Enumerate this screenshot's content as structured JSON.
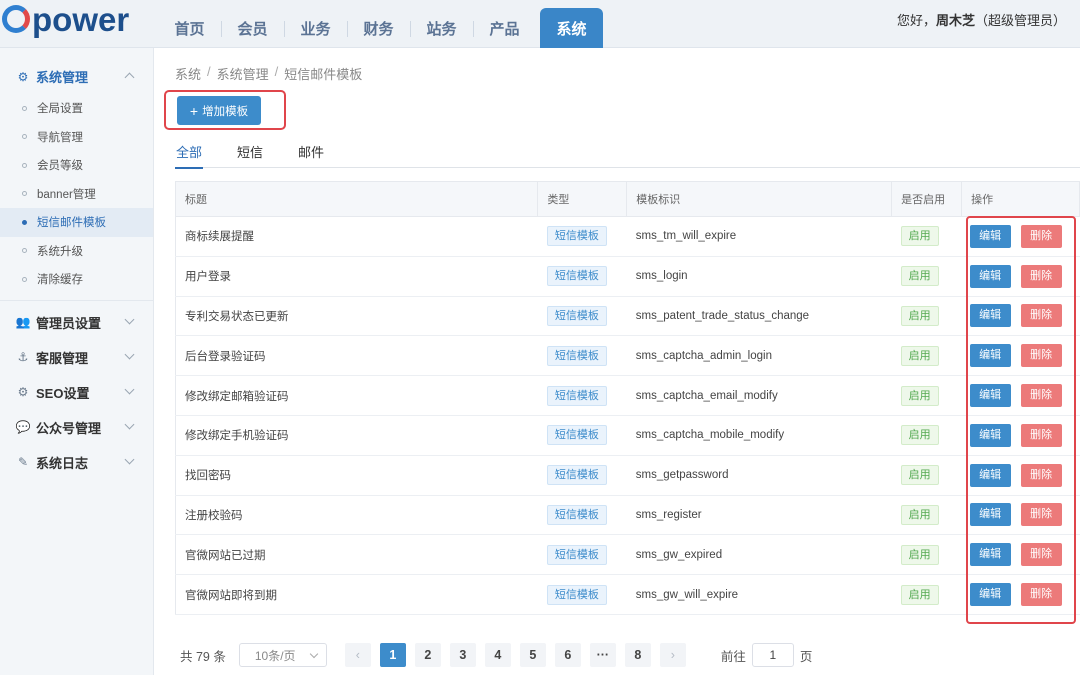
{
  "header": {
    "logo_text": "power",
    "nav": [
      "首页",
      "会员",
      "业务",
      "财务",
      "站务",
      "产品",
      "系统"
    ],
    "greeting_prefix": "您好，",
    "user_name": "周木芝",
    "user_role": "（超级管理员）"
  },
  "sidebar": {
    "sections": [
      {
        "title": "系统管理",
        "icon": "gears-icon",
        "items": [
          "全局设置",
          "导航管理",
          "会员等级",
          "banner管理",
          "短信邮件模板",
          "系统升级",
          "清除缓存"
        ]
      },
      {
        "title": "管理员设置",
        "icon": "users-icon"
      },
      {
        "title": "客服管理",
        "icon": "headset-icon"
      },
      {
        "title": "SEO设置",
        "icon": "gear-icon"
      },
      {
        "title": "公众号管理",
        "icon": "wechat-icon"
      },
      {
        "title": "系统日志",
        "icon": "log-icon"
      }
    ]
  },
  "breadcrumb": [
    "系统",
    "系统管理",
    "短信邮件模板"
  ],
  "add_button": "增加模板",
  "tabs": [
    "全部",
    "短信",
    "邮件"
  ],
  "table": {
    "headers": [
      "标题",
      "类型",
      "模板标识",
      "是否启用",
      "操作"
    ],
    "rows": [
      {
        "title": "商标续展提醒",
        "type": "短信模板",
        "key": "sms_tm_will_expire",
        "status": "启用"
      },
      {
        "title": "用户登录",
        "type": "短信模板",
        "key": "sms_login",
        "status": "启用"
      },
      {
        "title": "专利交易状态已更新",
        "type": "短信模板",
        "key": "sms_patent_trade_status_change",
        "status": "启用"
      },
      {
        "title": "后台登录验证码",
        "type": "短信模板",
        "key": "sms_captcha_admin_login",
        "status": "启用"
      },
      {
        "title": "修改绑定邮箱验证码",
        "type": "短信模板",
        "key": "sms_captcha_email_modify",
        "status": "启用"
      },
      {
        "title": "修改绑定手机验证码",
        "type": "短信模板",
        "key": "sms_captcha_mobile_modify",
        "status": "启用"
      },
      {
        "title": "找回密码",
        "type": "短信模板",
        "key": "sms_getpassword",
        "status": "启用"
      },
      {
        "title": "注册校验码",
        "type": "短信模板",
        "key": "sms_register",
        "status": "启用"
      },
      {
        "title": "官微网站已过期",
        "type": "短信模板",
        "key": "sms_gw_expired",
        "status": "启用"
      },
      {
        "title": "官微网站即将到期",
        "type": "短信模板",
        "key": "sms_gw_will_expire",
        "status": "启用"
      }
    ],
    "edit_label": "编辑",
    "delete_label": "删除"
  },
  "pagination": {
    "total": "共 79 条",
    "page_size": "10条/页",
    "pages": [
      "1",
      "2",
      "3",
      "4",
      "5",
      "6",
      "···",
      "8"
    ],
    "current": "1",
    "goto_prefix": "前往",
    "goto_value": "1",
    "goto_suffix": "页"
  },
  "colors": {
    "accent": "#3d8ccb",
    "danger": "#ec7a7a",
    "highlight": "#e0454b"
  }
}
